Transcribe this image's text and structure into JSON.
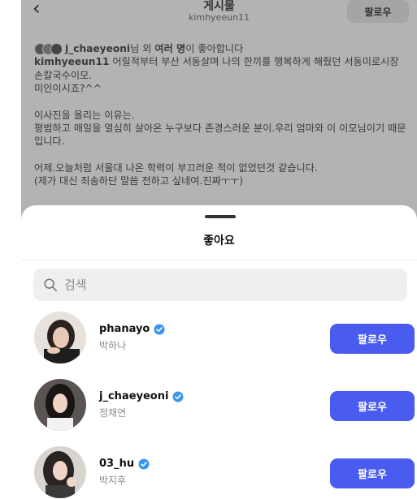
{
  "post": {
    "header_title": "게시물",
    "header_subtitle": "kimhyeeun11",
    "follow_label": "팔로우",
    "liked_by_user": "j_chaeyeoni",
    "liked_by_mid": "님 외 ",
    "liked_by_count": "여러 명",
    "liked_by_suffix": "이 좋아합니다",
    "caption_author": "kimhyeeun11",
    "caption_line1": " 어릴적부터 부산 서동살며 나의 한끼를 행복하게 해줬던 서동미로시장 손칼국수이모.",
    "caption_line2": "미인이시죠?^^",
    "caption_line3": " 이사진을 올리는 이유는.",
    "caption_line4": "평범하고 매일을 열심히 살아온 누구보다 존경스러운 분이.우리 엄마와 이 이모님이기 때문입니다.",
    "caption_line5": "어제.오늘처럼 서울대 나온 학력이 부끄러운 적이 없었던것 같습니다.",
    "caption_line6": "(제가 대신 죄송하단 말씀 전하고 싶네여.진짜ㅜㅜ)"
  },
  "sheet": {
    "title": "좋아요",
    "search_placeholder": "검색",
    "follow_label": "팔로우",
    "users": [
      {
        "username": "phanayo",
        "fullname": "박하나",
        "verified": true
      },
      {
        "username": "j_chaeyeoni",
        "fullname": "정채연",
        "verified": true
      },
      {
        "username": "03_hu",
        "fullname": "박지후",
        "verified": true
      }
    ]
  },
  "colors": {
    "accent": "#4a5cf0",
    "overlay": "#b3b3b3",
    "verified": "#3897f0"
  },
  "icons": [
    "back-arrow-icon",
    "search-icon",
    "verified-badge-icon"
  ]
}
